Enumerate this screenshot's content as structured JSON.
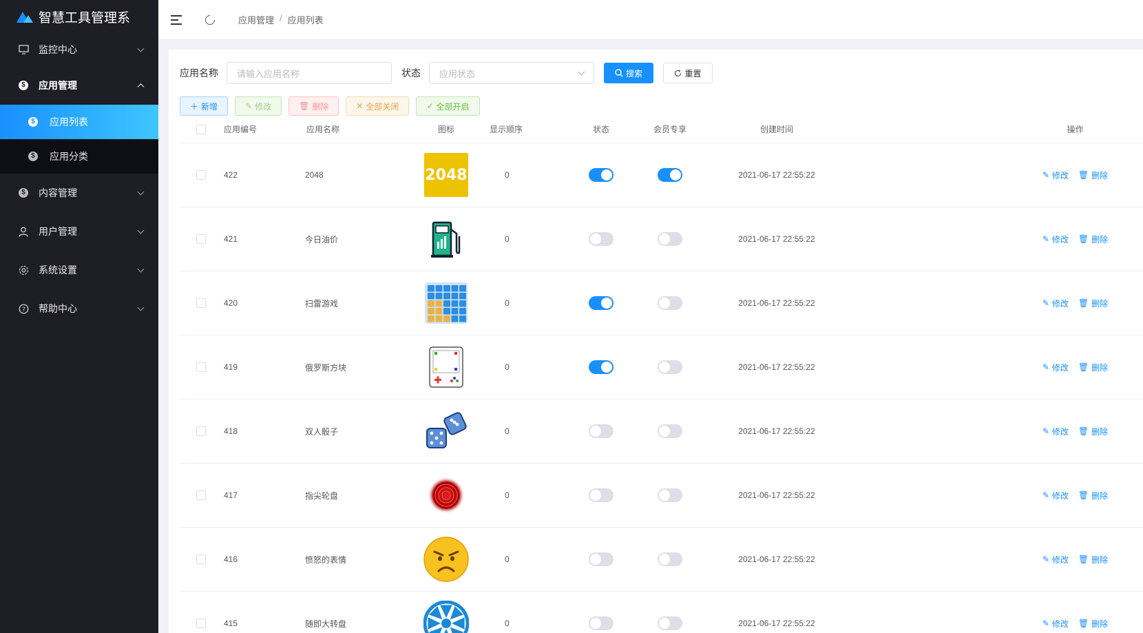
{
  "app": {
    "title": "智慧工具管理系"
  },
  "sidebar": {
    "items": [
      {
        "label": "监控中心"
      },
      {
        "label": "应用管理"
      },
      {
        "label": "内容管理"
      },
      {
        "label": "用户管理"
      },
      {
        "label": "系统设置"
      },
      {
        "label": "帮助中心"
      }
    ],
    "submenu": [
      {
        "label": "应用列表"
      },
      {
        "label": "应用分类"
      }
    ]
  },
  "breadcrumb": {
    "level1": "应用管理",
    "sep": "/",
    "level2": "应用列表"
  },
  "filters": {
    "name_label": "应用名称",
    "name_placeholder": "请输入应用名称",
    "status_label": "状态",
    "status_placeholder": "应用状态",
    "search_label": "搜索",
    "reset_label": "重置"
  },
  "actions": {
    "add": "新增",
    "edit": "修改",
    "delete": "删除",
    "close_all": "全部关闭",
    "open_all": "全部开启"
  },
  "table": {
    "columns": {
      "id": "应用编号",
      "name": "应用名称",
      "icon": "图标",
      "order": "显示顺序",
      "status": "状态",
      "member": "会员专享",
      "created": "创建时间",
      "ops": "操作"
    },
    "rows": [
      {
        "id": "422",
        "name": "2048",
        "icon": "2048-tile-icon",
        "order": "0",
        "status": true,
        "member": true,
        "created": "2021-06-17 22:55:22",
        "edit": "修改",
        "delete": "删除"
      },
      {
        "id": "421",
        "name": "今日油价",
        "icon": "fuel-pump-icon",
        "order": "0",
        "status": false,
        "member": false,
        "created": "2021-06-17 22:55:22",
        "edit": "修改",
        "delete": "删除"
      },
      {
        "id": "420",
        "name": "扫雷游戏",
        "icon": "minesweeper-grid-icon",
        "order": "0",
        "status": true,
        "member": false,
        "created": "2021-06-17 22:55:22",
        "edit": "修改",
        "delete": "删除"
      },
      {
        "id": "419",
        "name": "俄罗斯方块",
        "icon": "tetris-console-icon",
        "order": "0",
        "status": true,
        "member": false,
        "created": "2021-06-17 22:55:22",
        "edit": "修改",
        "delete": "删除"
      },
      {
        "id": "418",
        "name": "双人骰子",
        "icon": "dice-icon",
        "order": "0",
        "status": false,
        "member": false,
        "created": "2021-06-17 22:55:22",
        "edit": "修改",
        "delete": "删除"
      },
      {
        "id": "417",
        "name": "指尖轮盘",
        "icon": "red-spinner-icon",
        "order": "0",
        "status": false,
        "member": false,
        "created": "2021-06-17 22:55:22",
        "edit": "修改",
        "delete": "删除"
      },
      {
        "id": "416",
        "name": "愤怒的表情",
        "icon": "angry-face-icon",
        "order": "0",
        "status": false,
        "member": false,
        "created": "2021-06-17 22:55:22",
        "edit": "修改",
        "delete": "删除"
      },
      {
        "id": "415",
        "name": "随即大转盘",
        "icon": "wheel-icon",
        "order": "0",
        "status": false,
        "member": false,
        "created": "2021-06-17 22:55:22",
        "edit": "修改",
        "delete": "删除"
      }
    ],
    "icon_text": {
      "tile_2048": "2048"
    }
  },
  "colors": {
    "primary": "#1890ff",
    "sidebar": "#1d1e26"
  }
}
